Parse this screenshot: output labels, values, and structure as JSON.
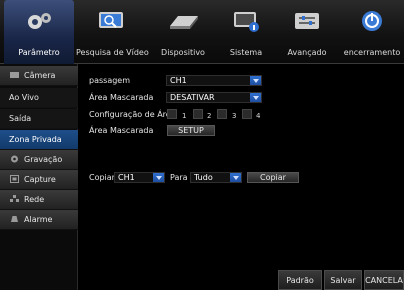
{
  "top_tabs": [
    {
      "label": "Parâmetro",
      "icon": "gear-icon"
    },
    {
      "label": "Pesquisa de Vídeo",
      "icon": "search-video-icon"
    },
    {
      "label": "Dispositivo",
      "icon": "hard-disk-icon"
    },
    {
      "label": "Sistema",
      "icon": "monitor-info-icon"
    },
    {
      "label": "Avançado",
      "icon": "advanced-panel-icon"
    },
    {
      "label": "encerramento",
      "icon": "power-icon"
    }
  ],
  "sidebar": {
    "items": [
      {
        "label": "Câmera",
        "icon": "camera-icon"
      },
      {
        "label": "Ao Vivo"
      },
      {
        "label": "Saída"
      },
      {
        "label": "Zona Privada"
      },
      {
        "label": "Gravação",
        "icon": "gear-small-icon"
      },
      {
        "label": "Capture",
        "icon": "capture-icon"
      },
      {
        "label": "Rede",
        "icon": "network-icon"
      },
      {
        "label": "Alarme",
        "icon": "alarm-icon"
      }
    ]
  },
  "form": {
    "passagem_label": "passagem",
    "passagem_value": "CH1",
    "area_mascarada_label": "Área Mascarada",
    "area_mascarada_value": "DESATIVAR",
    "config_area_label": "Configuração de Área",
    "areas": [
      "1",
      "2",
      "3",
      "4"
    ],
    "area_mascarada2_label": "Área Mascarada",
    "setup_label": "SETUP"
  },
  "copy": {
    "copiar_label": "Copiar",
    "copiar_value": "CH1",
    "para_label": "Para",
    "para_value": "Tudo",
    "copy_button": "Copiar"
  },
  "footer": {
    "default_button": "Padrão",
    "save_button": "Salvar",
    "cancel_button": "CANCELA"
  },
  "colors": {
    "active_blue": "#1e4e8a",
    "dropdown_arrow": "#2f6fd0"
  }
}
